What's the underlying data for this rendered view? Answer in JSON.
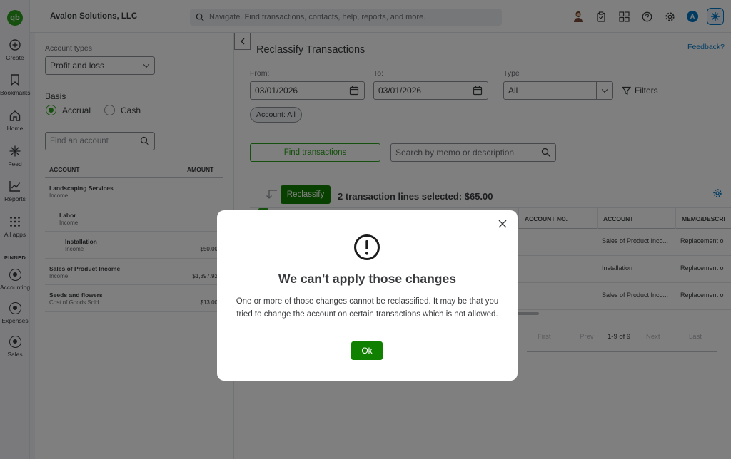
{
  "nav": {
    "logo": "qb",
    "items": [
      {
        "label": "Create",
        "icon": "plus-circle-icon"
      },
      {
        "label": "Bookmarks",
        "icon": "bookmark-icon"
      },
      {
        "label": "Home",
        "icon": "home-icon"
      },
      {
        "label": "Feed",
        "icon": "sparkle-icon"
      },
      {
        "label": "Reports",
        "icon": "chart-line-icon"
      },
      {
        "label": "All apps",
        "icon": "grid-icon"
      }
    ],
    "pinned_label": "PINNED",
    "pinned": [
      {
        "label": "Accounting",
        "icon": "accounting-icon"
      },
      {
        "label": "Expenses",
        "icon": "expenses-icon"
      },
      {
        "label": "Sales",
        "icon": "sales-icon"
      }
    ]
  },
  "topbar": {
    "company": "Avalon Solutions, LLC",
    "search_placeholder": "Navigate. Find transactions, contacts, help, reports, and more.",
    "avatar_letter": "A"
  },
  "left_panel": {
    "account_types_label": "Account types",
    "account_types_value": "Profit and loss",
    "basis_label": "Basis",
    "basis_options": [
      "Accrual",
      "Cash"
    ],
    "basis_selected": "Accrual",
    "find_account_placeholder": "Find an account",
    "table": {
      "headers": [
        "ACCOUNT",
        "AMOUNT"
      ],
      "rows": [
        {
          "name": "Landscaping Services",
          "type": "Income",
          "amount": "",
          "indent": 0
        },
        {
          "name": "Labor",
          "type": "Income",
          "amount": "",
          "indent": 1
        },
        {
          "name": "Installation",
          "type": "Income",
          "amount": "$50.00",
          "indent": 2
        },
        {
          "name": "Sales of Product Income",
          "type": "Income",
          "amount": "$1,397.92",
          "indent": 0
        },
        {
          "name": "Seeds and flowers",
          "type": "Cost of Goods Sold",
          "amount": "$13.00",
          "indent": 0
        }
      ]
    }
  },
  "main": {
    "title": "Reclassify Transactions",
    "feedback": "Feedback?",
    "from_label": "From:",
    "from_value": "03/01/2026",
    "to_label": "To:",
    "to_value": "03/01/2026",
    "type_label": "Type",
    "type_value": "All",
    "filters_label": "Filters",
    "chip": "Account: All",
    "find_button": "Find transactions",
    "memo_placeholder": "Search by memo or description",
    "reclassify_button": "Reclassify",
    "selection_text": "2 transaction lines selected: $65.00",
    "columns": [
      "ACCOUNT NO.",
      "ACCOUNT",
      "MEMO/DESCRI"
    ],
    "rows": [
      {
        "account": "Sales of Product Inco...",
        "memo": "Replacement o"
      },
      {
        "account": "Installation",
        "memo": "Replacement o"
      },
      {
        "account": "Sales of Product Inco...",
        "memo": "Replacement o"
      }
    ],
    "pager": {
      "first": "First",
      "prev": "Prev",
      "range": "1-9 of 9",
      "next": "Next",
      "last": "Last"
    }
  },
  "dialog": {
    "title": "We can't apply those changes",
    "body": "One or more of those changes cannot be reclassified. It may be that you tried to change the account on certain transactions which is not allowed.",
    "ok": "Ok"
  },
  "colors": {
    "brand_green": "#2ca01c",
    "button_green": "#108000",
    "link_blue": "#0077c5"
  }
}
